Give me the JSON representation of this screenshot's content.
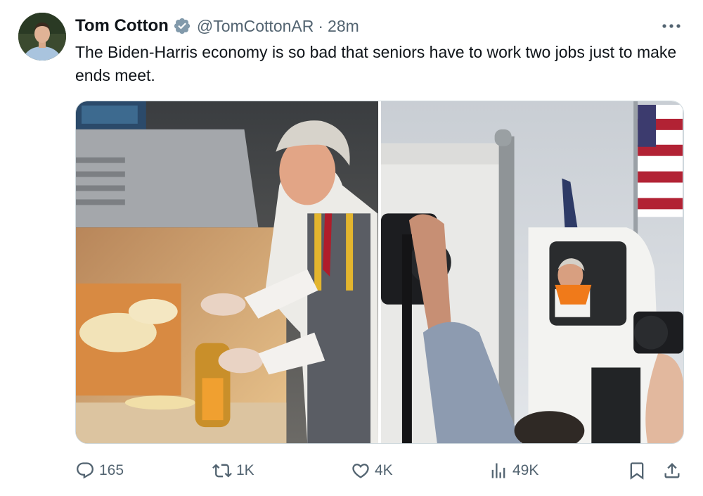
{
  "tweet": {
    "author_name": "Tom Cotton",
    "handle": "@TomCottonAR",
    "separator": "·",
    "time": "28m",
    "verified": true,
    "text": "The Biden-Harris economy is so bad that seniors have to work two jobs just to make ends meet."
  },
  "media": {
    "count": 2
  },
  "actions": {
    "replies": "165",
    "reposts": "1K",
    "likes": "4K",
    "views": "49K"
  },
  "icons": {
    "verified": "verified-badge-icon",
    "more": "more-options-icon",
    "reply": "reply-icon",
    "repost": "repost-icon",
    "like": "like-icon",
    "views": "views-icon",
    "bookmark": "bookmark-icon",
    "share": "share-icon"
  },
  "colors": {
    "text_primary": "#0f1419",
    "text_secondary": "#536471",
    "verified": "#829aab",
    "border": "#cfd9de"
  }
}
